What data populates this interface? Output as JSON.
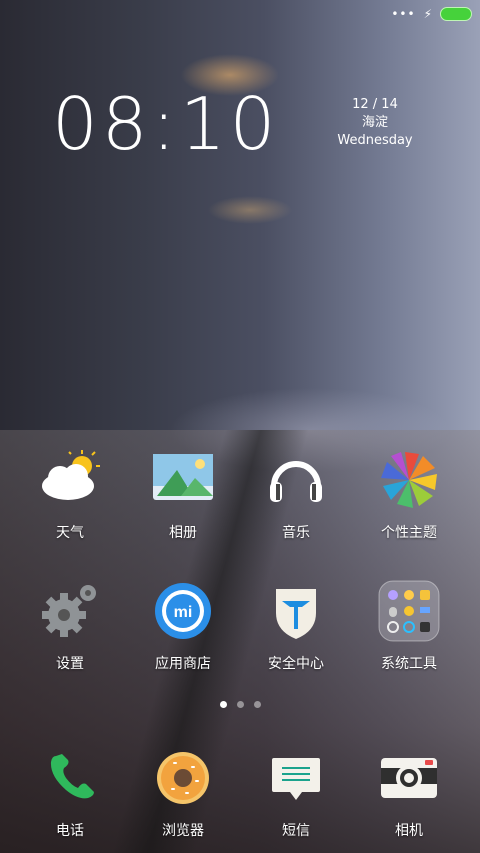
{
  "status": {
    "dots": "•••",
    "charging_icon": "lightning-icon",
    "battery_color": "#46d23b"
  },
  "clock": {
    "time": "08:10",
    "date": "12 / 14",
    "location": "海淀",
    "weekday": "Wednesday"
  },
  "apps_row1": [
    {
      "label": "天气",
      "icon": "weather-icon"
    },
    {
      "label": "相册",
      "icon": "gallery-icon"
    },
    {
      "label": "音乐",
      "icon": "music-headphones-icon"
    },
    {
      "label": "个性主题",
      "icon": "themes-icon"
    }
  ],
  "apps_row2": [
    {
      "label": "设置",
      "icon": "settings-gear-icon"
    },
    {
      "label": "应用商店",
      "icon": "mi-store-icon"
    },
    {
      "label": "安全中心",
      "icon": "security-shield-icon"
    },
    {
      "label": "系统工具",
      "icon": "tools-folder-icon"
    }
  ],
  "pager": {
    "count": 3,
    "active": 1
  },
  "dock": [
    {
      "label": "电话",
      "icon": "phone-icon"
    },
    {
      "label": "浏览器",
      "icon": "browser-donut-icon"
    },
    {
      "label": "短信",
      "icon": "messages-icon"
    },
    {
      "label": "相机",
      "icon": "camera-icon"
    }
  ]
}
